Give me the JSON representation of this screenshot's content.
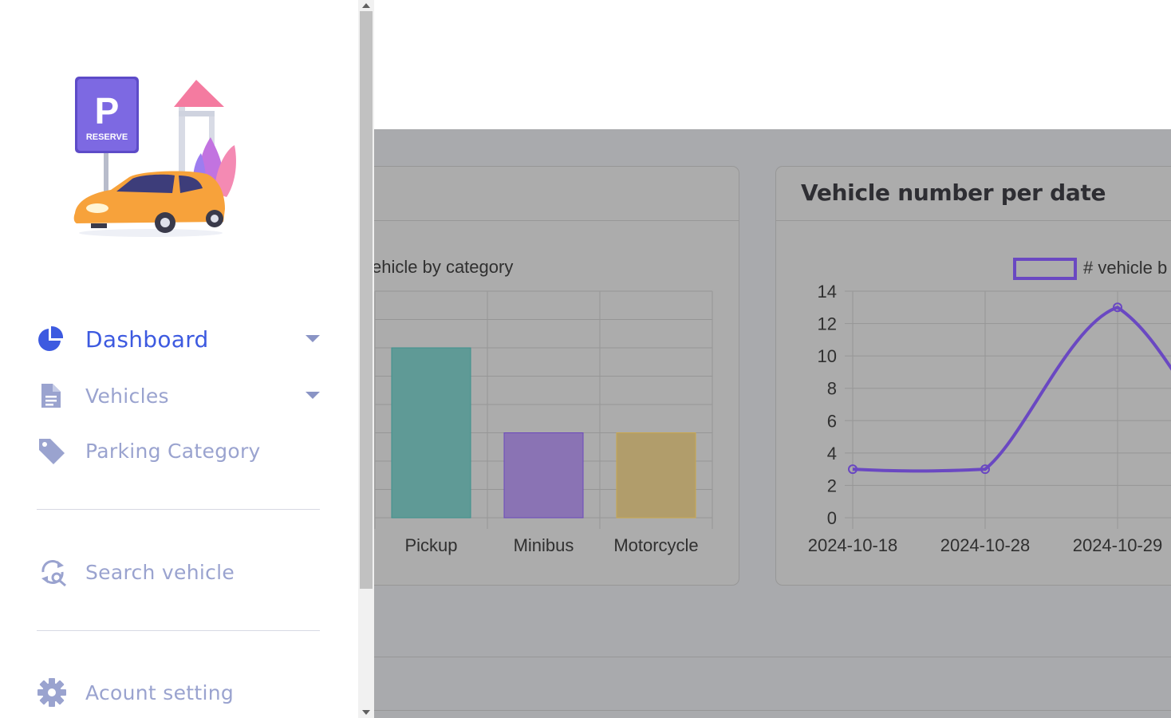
{
  "sidebar": {
    "nav": [
      {
        "label": "Dashboard",
        "icon": "pie-chart-icon",
        "active": true,
        "has_caret": true
      },
      {
        "label": "Vehicles",
        "icon": "document-icon",
        "active": false,
        "has_caret": true
      },
      {
        "label": "Parking Category",
        "icon": "tag-icon",
        "active": false,
        "has_caret": false
      }
    ],
    "search": {
      "label": "Search vehicle",
      "icon": "search-refresh-icon"
    },
    "settings": {
      "label": "Acount setting",
      "icon": "gear-icon"
    },
    "logo": {
      "sign_letter": "P",
      "sign_text": "RESERVE"
    }
  },
  "colors": {
    "accent": "#3d5ae0",
    "nav_muted": "#9aa3cf",
    "overlay": "#a9aaad"
  },
  "cards": {
    "category": {
      "title": "",
      "chart_data": {
        "type": "bar",
        "title": "",
        "legend_label": "Vehicle by category",
        "legend_label_visible": "ehicle by category",
        "categories": [
          "Pickup",
          "Minibus",
          "Motorcycle"
        ],
        "values": [
          6,
          3,
          3
        ],
        "colors": [
          "#5f9a96",
          "#8a73b4",
          "#b19d6b"
        ],
        "border_colors": [
          "#3c918d",
          "#6b48bb",
          "#c9a74d"
        ],
        "grid": true
      }
    },
    "per_date": {
      "title": "Vehicle number per date",
      "chart_data": {
        "type": "line",
        "legend_label": "# vehicle b",
        "x": [
          "2024-10-18",
          "2024-10-28",
          "2024-10-29"
        ],
        "values": [
          3,
          3,
          13
        ],
        "ylim": [
          0,
          14
        ],
        "yticks": [
          "0",
          "2",
          "4",
          "6",
          "8",
          "10",
          "12",
          "14"
        ],
        "color": "#6a48c2",
        "grid": true
      }
    }
  }
}
